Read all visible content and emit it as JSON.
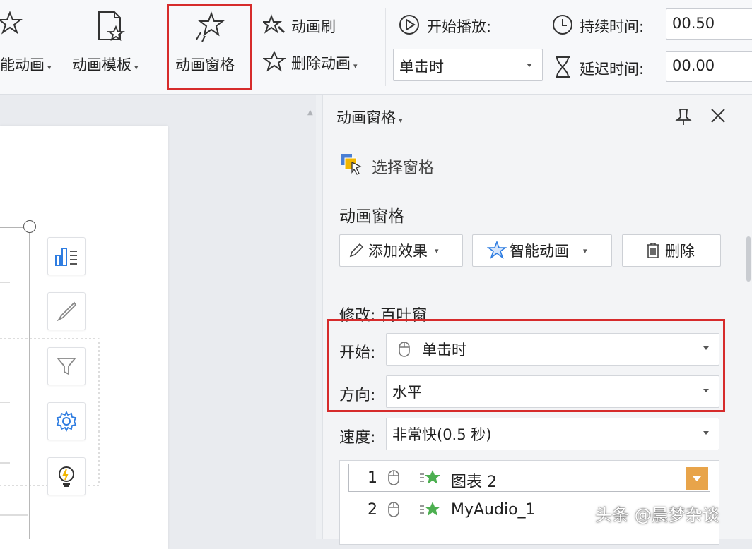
{
  "ribbon": {
    "smart_anim_label": "能动画",
    "template_label": "动画模板",
    "pane_label": "动画窗格",
    "brush_label": "动画刷",
    "delete_anim_label": "删除动画",
    "start_play_label": "开始播放:",
    "start_value": "单击时",
    "duration_label": "持续时间:",
    "duration_value": "00.50",
    "delay_label": "延迟时间:",
    "delay_value": "00.00"
  },
  "panel": {
    "title": "动画窗格",
    "select_pane": "选择窗格",
    "section_title": "动画窗格",
    "add_effect": "添加效果",
    "smart_anim": "智能动画",
    "delete": "删除",
    "modify_label": "修改: 百叶窗",
    "start_label": "开始:",
    "start_value": "单击时",
    "direction_label": "方向:",
    "direction_value": "水平",
    "speed_label": "速度:",
    "speed_value": "非常快(0.5 秒)",
    "items": [
      {
        "index": "1",
        "name": "图表 2"
      },
      {
        "index": "2",
        "name": "MyAudio_1"
      }
    ]
  },
  "watermark": "头条 @晨梦杂谈",
  "colors": {
    "highlight": "#d62b2b",
    "star": "#4caf50",
    "orange": "#e8a44a"
  }
}
